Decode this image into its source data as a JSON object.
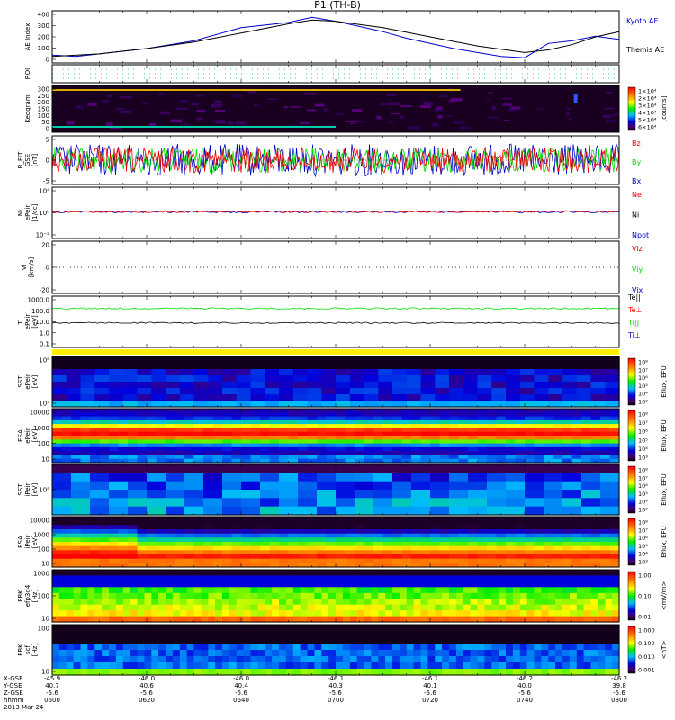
{
  "title": "P1 (TH-B)",
  "date_label": "2013 Mar 24",
  "ephemeris": {
    "row_labels": [
      "X-GSE",
      "Y-GSE",
      "Z-GSE",
      "hhmm"
    ],
    "columns": [
      [
        "-45.9",
        "40.7",
        "-5.6",
        "0600"
      ],
      [
        "-46.0",
        "40.6",
        "-5.6",
        "0620"
      ],
      [
        "-46.0",
        "40.4",
        "-5.6",
        "0640"
      ],
      [
        "-46.1",
        "40.3",
        "-5.6",
        "0700"
      ],
      [
        "-46.1",
        "40.1",
        "-5.6",
        "0720"
      ],
      [
        "-46.2",
        "40.0",
        "-5.6",
        "0740"
      ],
      [
        "-46.2",
        "39.8",
        "-5.6",
        "0800"
      ]
    ]
  },
  "colors": {
    "blue": "#0000cc",
    "green": "#00dd00",
    "red": "#ee0000",
    "black": "#000000",
    "yellow": "#ffee00",
    "cyan": "#00cccc"
  },
  "chart_data": [
    {
      "type": "line",
      "ylabel": "AE Index",
      "ylim": [
        0,
        400
      ],
      "yticks": [
        "0",
        "100",
        "200",
        "300",
        "400"
      ],
      "x_range": [
        "0600",
        "0800"
      ],
      "series": [
        {
          "name": "Kyoto AE",
          "color": "#0000cc",
          "x": [
            0,
            5,
            10,
            20,
            30,
            40,
            50,
            55,
            60,
            65,
            70,
            75,
            80,
            85,
            90,
            95,
            100,
            105,
            110,
            115,
            120
          ],
          "values": [
            60,
            50,
            70,
            110,
            170,
            270,
            310,
            350,
            320,
            280,
            240,
            190,
            150,
            110,
            80,
            50,
            40,
            150,
            170,
            205,
            180
          ]
        },
        {
          "name": "Themis AE",
          "color": "#000000",
          "x": [
            0,
            10,
            20,
            30,
            40,
            50,
            55,
            60,
            70,
            80,
            90,
            100,
            105,
            110,
            115,
            120
          ],
          "values": [
            50,
            70,
            110,
            160,
            230,
            300,
            330,
            320,
            270,
            200,
            130,
            80,
            100,
            140,
            200,
            240
          ]
        }
      ]
    },
    {
      "type": "line",
      "ylabel": "ROI",
      "note": "dotted flag row, no values printed"
    },
    {
      "type": "heatmap",
      "ylabel": "Keogram",
      "ylim": [
        0,
        300
      ],
      "yticks": [
        "0",
        "50",
        "100",
        "150",
        "200",
        "250",
        "300"
      ],
      "colorbar": {
        "label": "[counts]",
        "ticks": [
          "1×10⁴",
          "2×10⁴",
          "3×10⁴",
          "4×10⁴",
          "5×10⁴",
          "6×10⁴"
        ]
      }
    },
    {
      "type": "line",
      "ylabel": "B_FIT\nGSE\n[nT]",
      "ylim": [
        -10,
        10
      ],
      "yticks": [
        "-5",
        "0",
        "5"
      ],
      "series": [
        {
          "name": "Bz",
          "color": "#ee0000"
        },
        {
          "name": "By",
          "color": "#00dd00"
        },
        {
          "name": "Bx",
          "color": "#0000cc"
        }
      ]
    },
    {
      "type": "line",
      "ylabel": "Ni\nePeir\n[1/cc]",
      "yticks": [
        "10⁴",
        "10⁰",
        "10⁻²"
      ],
      "series": [
        {
          "name": "Ne",
          "color": "#ee0000"
        },
        {
          "name": "Ni",
          "color": "#000000"
        },
        {
          "name": "Npot",
          "color": "#0000cc"
        }
      ]
    },
    {
      "type": "line",
      "ylabel": "Vi\n[km/s]",
      "yticks": [
        "20",
        "0",
        "-20"
      ],
      "series": [
        {
          "name": "Viz",
          "color": "#ee0000"
        },
        {
          "name": "Viy",
          "color": "#00dd00"
        },
        {
          "name": "Vix",
          "color": "#0000cc"
        }
      ]
    },
    {
      "type": "line",
      "ylabel": "Ti\nePeir\n[eV]",
      "yticks": [
        "1000.0",
        "100.0",
        "10.0",
        "1.0",
        "0.1"
      ],
      "series": [
        {
          "name": "Te||",
          "color": "#000000"
        },
        {
          "name": "Te⊥",
          "color": "#ee0000"
        },
        {
          "name": "Ti||",
          "color": "#00dd00"
        },
        {
          "name": "Ti⊥",
          "color": "#0000cc"
        }
      ]
    },
    {
      "type": "heatmap",
      "ylabel": "SST\nePeir\n[eV]",
      "yticks": [
        "10⁶",
        "10⁵"
      ],
      "colorbar": {
        "label": "Eflux, EFU",
        "ticks": [
          "10⁸",
          "10⁷",
          "10⁶",
          "10⁵",
          "10⁴",
          "10³"
        ]
      }
    },
    {
      "type": "heatmap",
      "ylabel": "ESA\nePeir\n[eV]",
      "yticks": [
        "10000",
        "1000",
        "100",
        "10"
      ],
      "colorbar": {
        "label": "Eflux, EFU",
        "ticks": [
          "10⁸",
          "10⁷",
          "10⁶",
          "10⁵",
          "10⁴",
          "10³"
        ]
      }
    },
    {
      "type": "heatmap",
      "ylabel": "SST\niPeir\n[eV]",
      "yticks": [
        "10⁵"
      ],
      "colorbar": {
        "label": "Eflux, EFU",
        "ticks": [
          "10⁸",
          "10⁷",
          "10⁶",
          "10⁵",
          "10⁴",
          "10³"
        ]
      }
    },
    {
      "type": "heatmap",
      "ylabel": "ESA\niPeir\n[eV]",
      "yticks": [
        "10000",
        "1000",
        "100",
        "10"
      ],
      "colorbar": {
        "label": "Eflux, EFU",
        "ticks": [
          "10⁸",
          "10⁷",
          "10⁶",
          "10⁵",
          "10⁴",
          "10³"
        ]
      }
    },
    {
      "type": "heatmap",
      "ylabel": "FBK\nefp3d4\n[Hz]",
      "yticks": [
        "1000",
        "100",
        "10"
      ],
      "colorbar": {
        "label": "<mV/m>",
        "ticks": [
          "1.00",
          "0.10",
          "0.01"
        ]
      }
    },
    {
      "type": "heatmap",
      "ylabel": "FBK\nscf\n[Hz]",
      "yticks": [
        "100",
        "10"
      ],
      "colorbar": {
        "label": "<nT>",
        "ticks": [
          "1.000",
          "0.100",
          "0.010",
          "0.001"
        ]
      }
    }
  ]
}
